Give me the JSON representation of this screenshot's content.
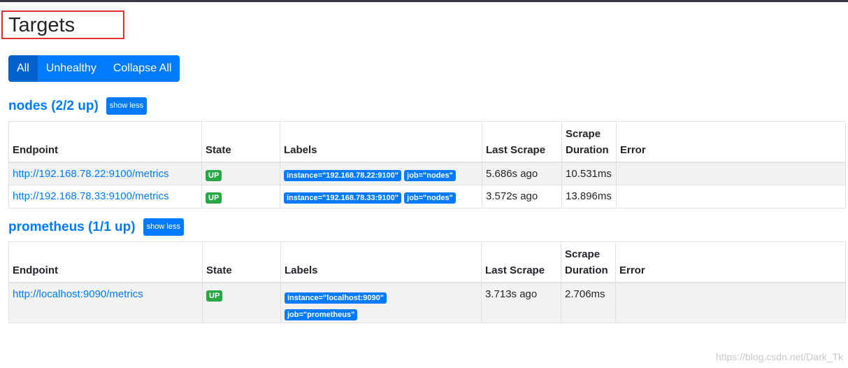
{
  "page": {
    "title": "Targets"
  },
  "filters": {
    "all": "All",
    "unhealthy": "Unhealthy",
    "collapse_all": "Collapse All"
  },
  "table_headers": {
    "endpoint": "Endpoint",
    "state": "State",
    "labels": "Labels",
    "last_scrape": "Last Scrape",
    "scrape": "Scrape",
    "duration": "Duration",
    "error": "Error"
  },
  "jobs": [
    {
      "title": "nodes (2/2 up)",
      "toggle_label": "show less",
      "rows": [
        {
          "endpoint": "http://192.168.78.22:9100/metrics",
          "state": "UP",
          "labels": [
            "instance=\"192.168.78.22:9100\"",
            "job=\"nodes\""
          ],
          "last_scrape": "5.686s ago",
          "duration": "10.531ms",
          "error": ""
        },
        {
          "endpoint": "http://192.168.78.33:9100/metrics",
          "state": "UP",
          "labels": [
            "instance=\"192.168.78.33:9100\"",
            "job=\"nodes\""
          ],
          "last_scrape": "3.572s ago",
          "duration": "13.896ms",
          "error": ""
        }
      ]
    },
    {
      "title": "prometheus (1/1 up)",
      "toggle_label": "show less",
      "rows": [
        {
          "endpoint": "http://localhost:9090/metrics",
          "state": "UP",
          "labels": [
            "instance=\"localhost:9090\"",
            "job=\"prometheus\""
          ],
          "last_scrape": "3.713s ago",
          "duration": "2.706ms",
          "error": ""
        }
      ]
    }
  ],
  "watermark": "https://blog.csdn.net/Dark_Tk",
  "colors": {
    "primary": "#007bff",
    "active": "#0062cc",
    "up": "#28a745",
    "highlight": "#e03030"
  }
}
